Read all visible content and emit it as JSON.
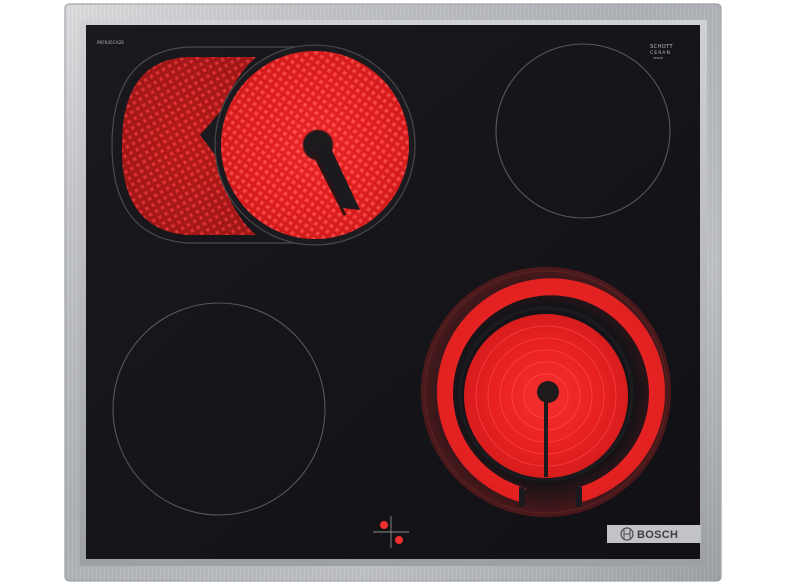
{
  "hob": {
    "model_code": "PKF645CA2E",
    "glass_brand_line1": "SCHOTT",
    "glass_brand_line2": "CERAN",
    "glass_brand_line3": "CERAN",
    "brand_name": "BOSCH",
    "frame_color": "#a9acb0",
    "glass_color": "#17161a",
    "heat_color": "#e61e1e",
    "badge_color": "#c2c3c7"
  },
  "zones": [
    {
      "id": "top-left",
      "state": "on",
      "type": "extended-oval"
    },
    {
      "id": "top-right",
      "state": "off",
      "type": "single"
    },
    {
      "id": "bottom-left",
      "state": "off",
      "type": "single"
    },
    {
      "id": "bottom-right",
      "state": "on",
      "type": "dual-circuit"
    }
  ]
}
